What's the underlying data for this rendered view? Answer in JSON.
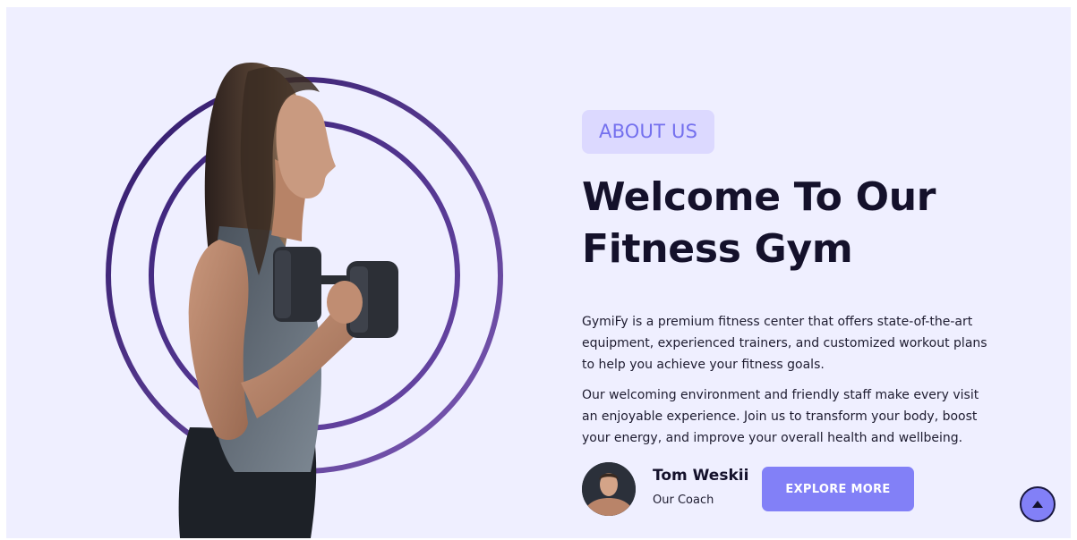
{
  "about": {
    "badge": "ABOUT US",
    "title_line1": "Welcome To Our",
    "title_line2": "Fitness Gym",
    "paragraph1": "GymiFy is a premium fitness center that offers state-of-the-art equipment, experienced trainers, and customized workout plans to help you achieve your fitness goals.",
    "paragraph2": "Our welcoming environment and friendly staff make every visit an enjoyable experience. Join us to transform your body, boost your energy, and improve your overall health and wellbeing."
  },
  "coach": {
    "name": "Tom Weskii",
    "role": "Our Coach"
  },
  "cta": {
    "explore_label": "EXPLORE MORE"
  },
  "icons": {
    "scroll_top": "arrow-up-icon"
  },
  "colors": {
    "background": "#efefff",
    "accent": "#8280f7",
    "badge_bg": "#dcd9ff",
    "badge_text": "#7470ee",
    "ring_dark": "#3b2270",
    "ring_light": "#7a56b0",
    "heading": "#14112b"
  }
}
